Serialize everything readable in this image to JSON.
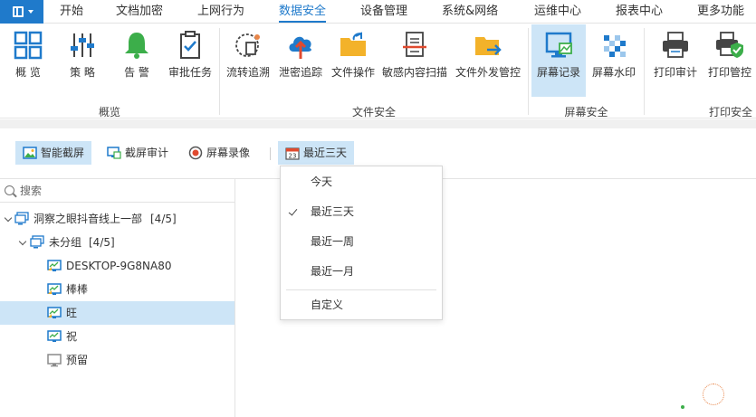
{
  "menu": {
    "items": [
      "开始",
      "文档加密",
      "上网行为",
      "数据安全",
      "设备管理",
      "系统&网络",
      "运维中心",
      "报表中心",
      "更多功能"
    ],
    "active": "数据安全"
  },
  "ribbon": {
    "groups": [
      {
        "label": "概览",
        "tools": [
          "概 览",
          "策 略",
          "告 警",
          "审批任务"
        ]
      },
      {
        "label": "文件安全",
        "tools": [
          "流转追溯",
          "泄密追踪",
          "文件操作",
          "敏感内容扫描",
          "文件外发管控"
        ]
      },
      {
        "label": "屏幕安全",
        "tools": [
          "屏幕记录",
          "屏幕水印"
        ]
      },
      {
        "label": "打印安全",
        "tools": [
          "打印审计",
          "打印管控"
        ]
      }
    ],
    "selected_tool": "屏幕记录"
  },
  "toolbar": {
    "smart_screenshot": "智能截屏",
    "screenshot_audit": "截屏审计",
    "screen_recording": "屏幕录像",
    "date_range": "最近三天"
  },
  "tree": {
    "search_placeholder": "搜索",
    "root": {
      "label": "洞察之眼抖音线上一部",
      "count": "[4/5]"
    },
    "group": {
      "label": "未分组",
      "count": "[4/5]"
    },
    "devices": [
      "DESKTOP-9G8NA80",
      "棒棒",
      "旺",
      "祝",
      "预留"
    ],
    "selected_device": "旺"
  },
  "dropdown": {
    "options": [
      "今天",
      "最近三天",
      "最近一周",
      "最近一月"
    ],
    "custom": "自定义",
    "checked": "最近三天"
  },
  "colors": {
    "accent": "#1f7acb",
    "selected_bg": "#cde5f7",
    "online_green": "#3cae4a",
    "offline_gray": "#8a8a8a"
  }
}
